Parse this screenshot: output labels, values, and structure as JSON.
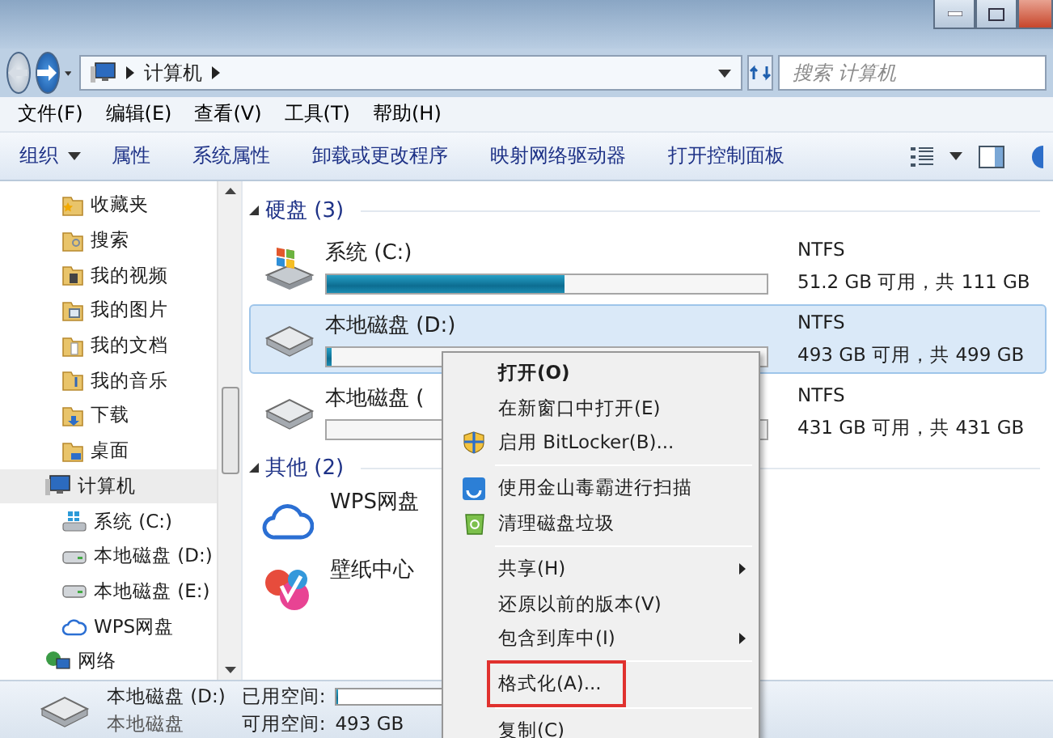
{
  "navigation": {
    "breadcrumb": [
      "计算机"
    ],
    "search_placeholder": "搜索 计算机"
  },
  "menu_bar": [
    "文件(F)",
    "编辑(E)",
    "查看(V)",
    "工具(T)",
    "帮助(H)"
  ],
  "toolbar": [
    {
      "label": "组织",
      "kind": "dropdown"
    },
    {
      "label": "属性",
      "kind": "plain"
    },
    {
      "label": "系统属性",
      "kind": "plain"
    },
    {
      "label": "卸载或更改程序",
      "kind": "plain"
    },
    {
      "label": "映射网络驱动器",
      "kind": "plain"
    },
    {
      "label": "打开控制面板",
      "kind": "plain"
    }
  ],
  "sidebar": {
    "partial_items": [
      {
        "label": "收藏夹",
        "kind": "star"
      },
      {
        "label": "搜索",
        "kind": "search"
      },
      {
        "label": "我的视频",
        "kind": "video"
      },
      {
        "label": "我的图片",
        "kind": "picture"
      },
      {
        "label": "我的文档",
        "kind": "document"
      },
      {
        "label": "我的音乐",
        "kind": "music"
      },
      {
        "label": "下载",
        "kind": "download"
      },
      {
        "label": "桌面",
        "kind": "desktop"
      }
    ],
    "tree": [
      {
        "label": "计算机",
        "kind": "computer",
        "selected": true,
        "children": [
          {
            "label": "系统 (C:)",
            "kind": "system",
            "selected": false
          },
          {
            "label": "本地磁盘 (D:)",
            "kind": "disk",
            "selected": false
          },
          {
            "label": "本地磁盘 (E:)",
            "kind": "disk",
            "selected": false
          },
          {
            "label": "WPS网盘",
            "kind": "cloud",
            "selected": false
          }
        ]
      },
      {
        "label": "网络",
        "kind": "network",
        "selected": false
      }
    ]
  },
  "groups": [
    {
      "title": "硬盘 (3)",
      "expanded": true,
      "items": [
        {
          "name": "系统 (C:)",
          "kind": "system",
          "selected": false,
          "filesystem": "NTFS",
          "level": 0.54,
          "reading": "51.2 GB 可用，共 111 GB"
        },
        {
          "name": "本地磁盘 (D:)",
          "kind": "disk",
          "selected": true,
          "filesystem": "NTFS",
          "level": 0.01,
          "reading": "493 GB 可用，共 499 GB"
        },
        {
          "name": "本地磁盘 (",
          "kind": "disk",
          "selected": false,
          "filesystem": "NTFS",
          "level": 0.0,
          "reading": "431 GB 可用，共 431 GB"
        }
      ]
    },
    {
      "title": "其他 (2)",
      "expanded": true,
      "items": [
        {
          "name": "WPS网盘",
          "kind": "cloud",
          "selected": false
        },
        {
          "name": "壁纸中心",
          "kind": "wallpaper",
          "selected": false
        }
      ]
    }
  ],
  "details": {
    "name": "本地磁盘 (D:)",
    "type": "本地磁盘",
    "used_label": "已用空间:",
    "level": 0.01,
    "free_label": "可用空间:",
    "free": "493 GB"
  },
  "context_menu": [
    {
      "kind": "plain",
      "label": "打开(O)",
      "bold": true,
      "submenu": false,
      "marked": false
    },
    {
      "kind": "plain",
      "label": "在新窗口中打开(E)",
      "bold": false,
      "submenu": false,
      "marked": false
    },
    {
      "kind": "bitlocker",
      "label": "启用 BitLocker(B)...",
      "bold": false,
      "submenu": false,
      "marked": false
    },
    {
      "kind": "separator"
    },
    {
      "kind": "scan",
      "label": "使用金山毒霸进行扫描",
      "bold": false,
      "submenu": false,
      "marked": false
    },
    {
      "kind": "cleanup",
      "label": "清理磁盘垃圾",
      "bold": false,
      "submenu": false,
      "marked": false
    },
    {
      "kind": "separator"
    },
    {
      "kind": "plain",
      "label": "共享(H)",
      "bold": false,
      "submenu": true,
      "marked": false
    },
    {
      "kind": "plain",
      "label": "还原以前的版本(V)",
      "bold": false,
      "submenu": false,
      "marked": false
    },
    {
      "kind": "plain",
      "label": "包含到库中(I)",
      "bold": false,
      "submenu": true,
      "marked": false
    },
    {
      "kind": "separator"
    },
    {
      "kind": "plain",
      "label": "格式化(A)...",
      "bold": false,
      "submenu": false,
      "marked": true
    },
    {
      "kind": "separator"
    },
    {
      "kind": "plain",
      "label": "复制(C)",
      "bold": false,
      "submenu": false,
      "marked": false
    }
  ]
}
